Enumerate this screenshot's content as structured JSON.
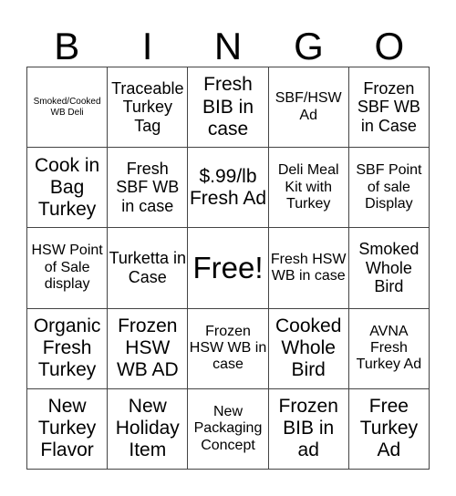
{
  "header": {
    "letters": [
      "B",
      "I",
      "N",
      "G",
      "O"
    ]
  },
  "cells": [
    {
      "text": "Smoked/Cooked WB Deli",
      "size": "xs"
    },
    {
      "text": "Traceable Turkey Tag",
      "size": "md"
    },
    {
      "text": "Fresh BIB in case",
      "size": "lg"
    },
    {
      "text": "SBF/HSW Ad",
      "size": "sm"
    },
    {
      "text": "Frozen SBF WB in Case",
      "size": "md"
    },
    {
      "text": "Cook in Bag Turkey",
      "size": "lg"
    },
    {
      "text": "Fresh SBF WB in case",
      "size": "md"
    },
    {
      "text": "$.99/lb Fresh Ad",
      "size": "lg"
    },
    {
      "text": "Deli Meal Kit with Turkey",
      "size": "sm"
    },
    {
      "text": "SBF Point of sale Display",
      "size": "sm"
    },
    {
      "text": "HSW Point of Sale display",
      "size": "sm"
    },
    {
      "text": "Turketta in Case",
      "size": "md"
    },
    {
      "text": "Free!",
      "size": "xl"
    },
    {
      "text": "Fresh HSW WB in case",
      "size": "sm"
    },
    {
      "text": "Smoked Whole Bird",
      "size": "md"
    },
    {
      "text": "Organic Fresh Turkey",
      "size": "lg"
    },
    {
      "text": "Frozen HSW WB AD",
      "size": "lg"
    },
    {
      "text": "Frozen HSW WB in case",
      "size": "sm"
    },
    {
      "text": "Cooked Whole Bird",
      "size": "lg"
    },
    {
      "text": "AVNA Fresh Turkey Ad",
      "size": "sm"
    },
    {
      "text": "New Turkey Flavor",
      "size": "lg"
    },
    {
      "text": "New Holiday Item",
      "size": "lg"
    },
    {
      "text": "New Packaging Concept",
      "size": "sm"
    },
    {
      "text": "Frozen BIB in ad",
      "size": "lg"
    },
    {
      "text": "Free Turkey Ad",
      "size": "lg"
    }
  ]
}
